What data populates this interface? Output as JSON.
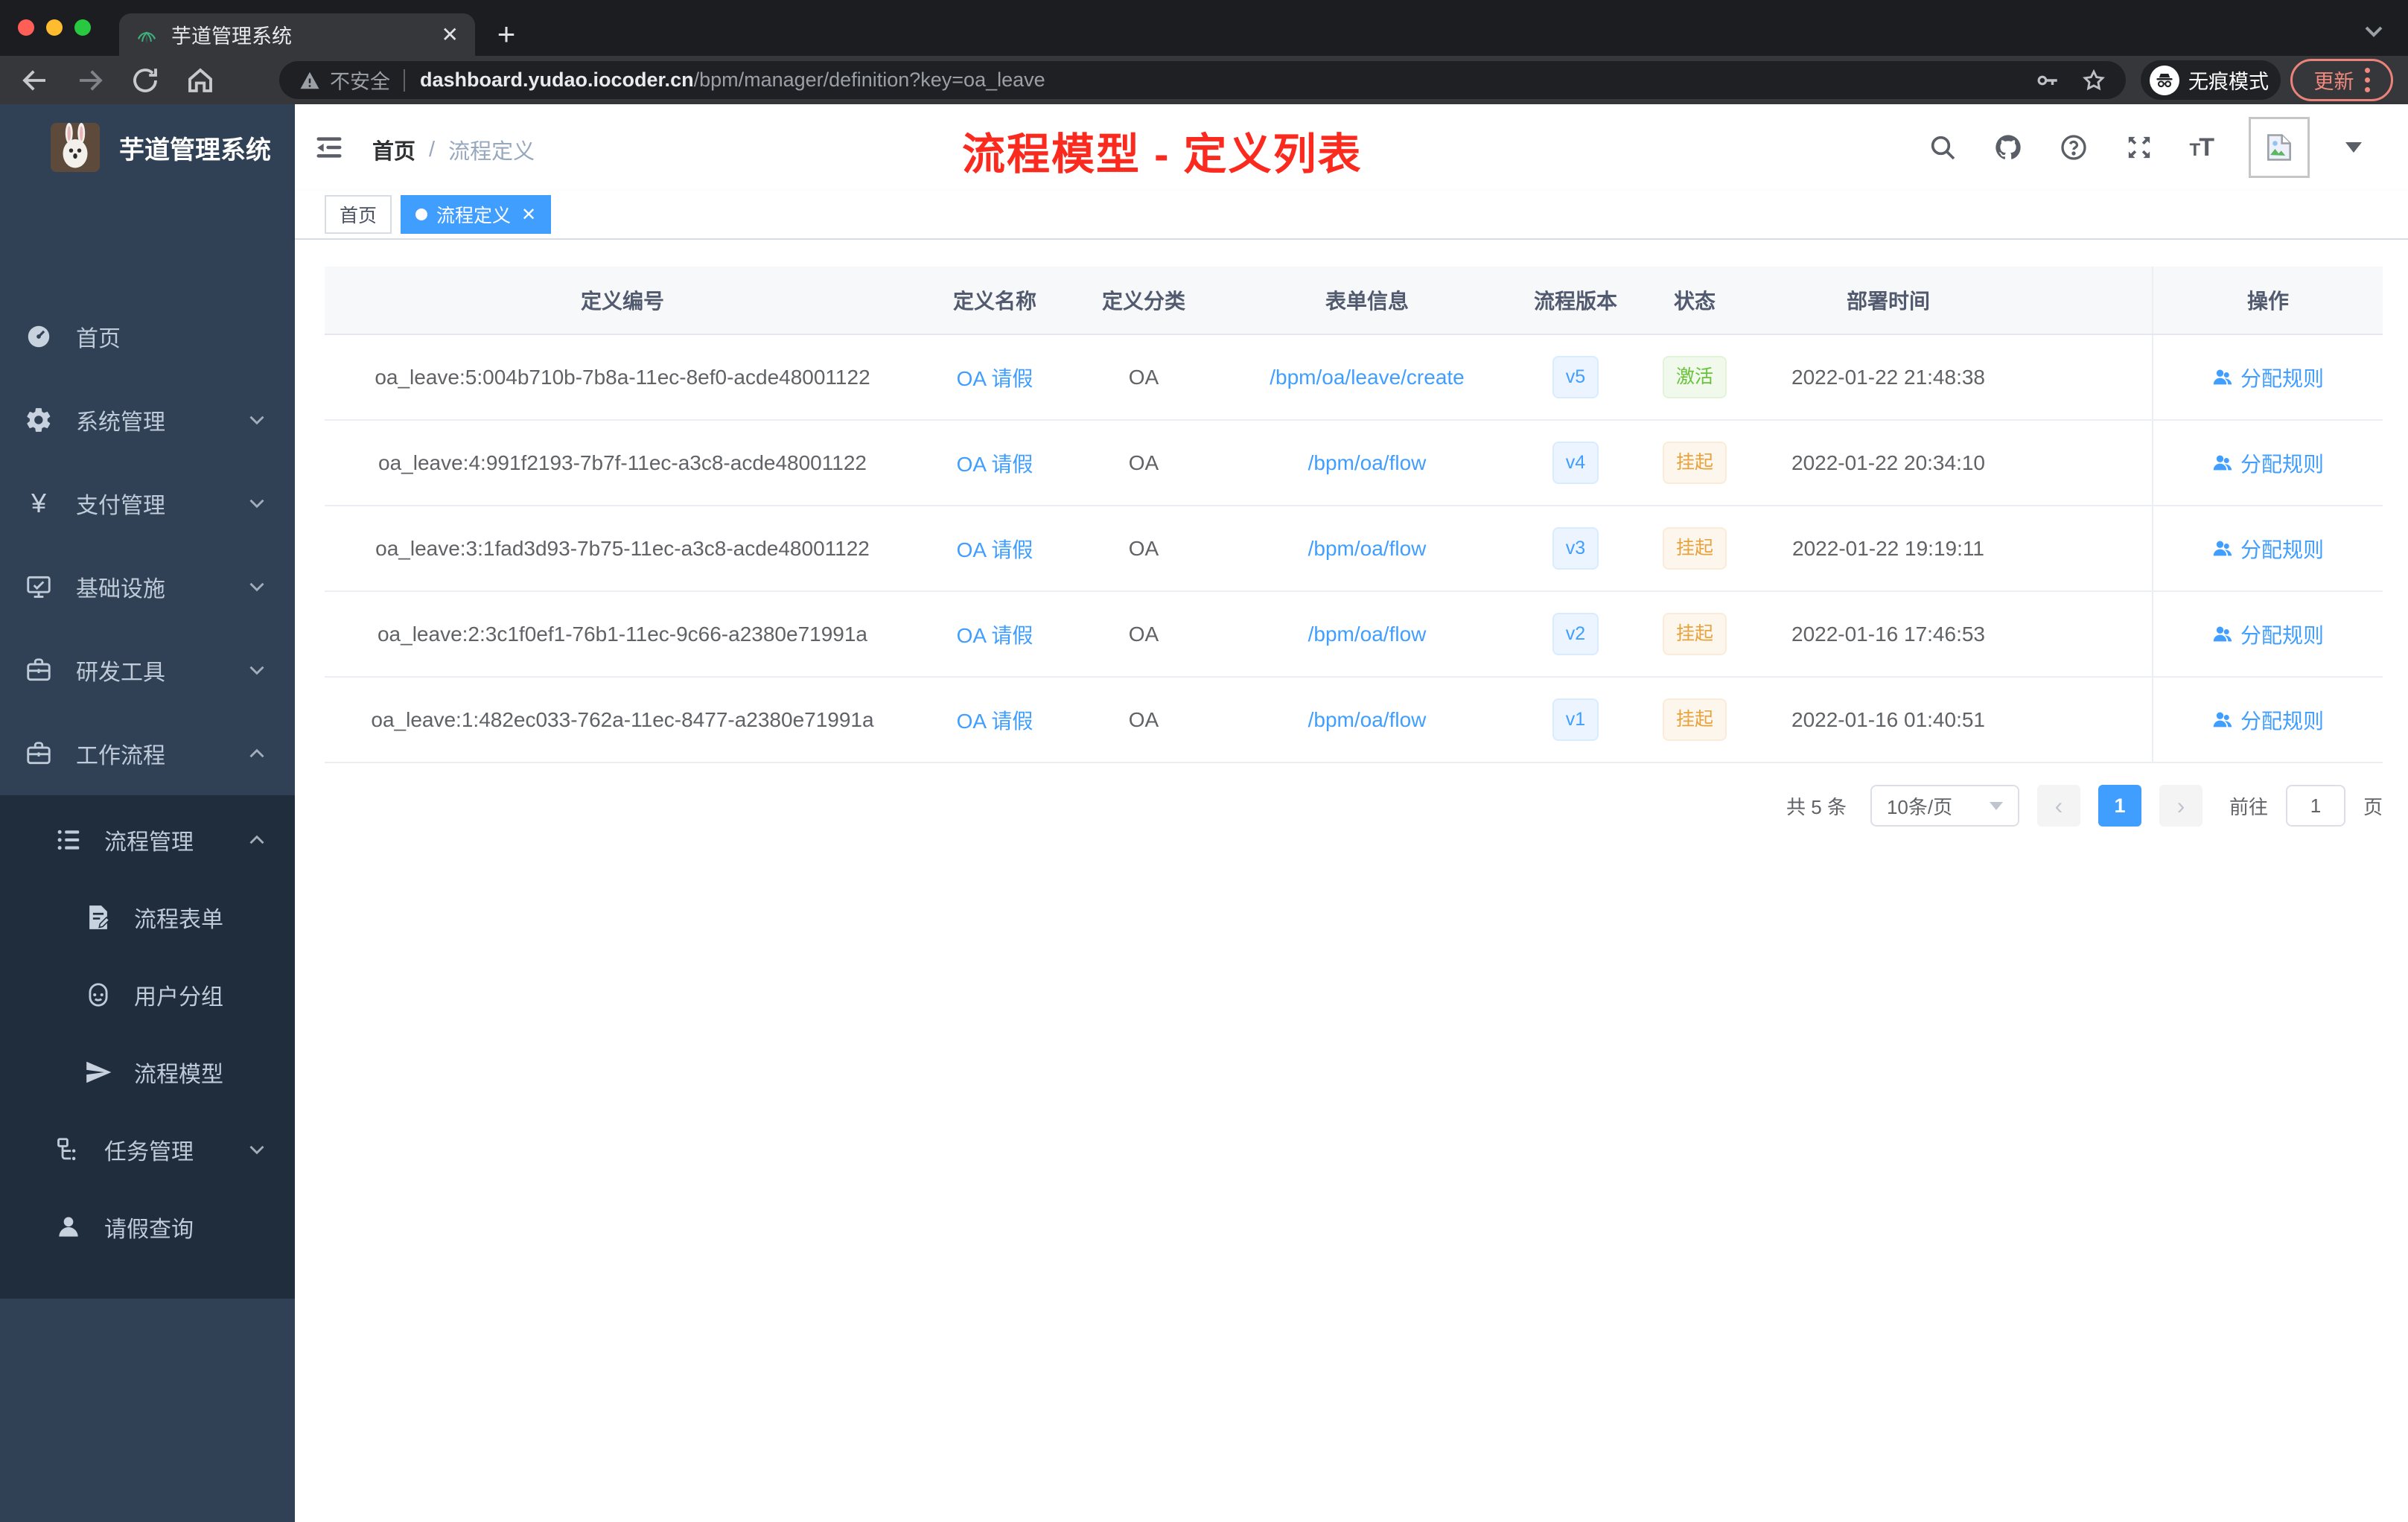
{
  "colors": {
    "accent": "#409eff",
    "sidebar_bg": "#304156",
    "submenu_bg": "#1f2d3d",
    "sidebar_text": "#bfcbd9",
    "success": "#67c23a",
    "warning": "#e6a23c",
    "annotation_red": "#fb2a1f",
    "chrome_dark": "#1c1d20",
    "toolbar_dark": "#36373a"
  },
  "browser": {
    "tab_title": "芋道管理系统",
    "new_tab_label": "+",
    "security_label": "不安全",
    "url_host": "dashboard.yudao.iocoder.cn",
    "url_path": "/bpm/manager/definition?key=oa_leave",
    "incognito_label": "无痕模式",
    "update_label": "更新"
  },
  "sidebar": {
    "app_title": "芋道管理系统",
    "menu": [
      {
        "label": "首页",
        "icon": "dashboard",
        "level": 1,
        "chevron": "",
        "sub": false
      },
      {
        "label": "系统管理",
        "icon": "gear",
        "level": 1,
        "chevron": "down",
        "sub": false
      },
      {
        "label": "支付管理",
        "icon": "yen",
        "level": 1,
        "chevron": "down",
        "sub": false
      },
      {
        "label": "基础设施",
        "icon": "monitor",
        "level": 1,
        "chevron": "down",
        "sub": false
      },
      {
        "label": "研发工具",
        "icon": "briefcase",
        "level": 1,
        "chevron": "down",
        "sub": false
      },
      {
        "label": "工作流程",
        "icon": "briefcase",
        "level": 1,
        "chevron": "up",
        "sub": false
      },
      {
        "label": "流程管理",
        "icon": "treelist",
        "level": 2,
        "chevron": "up",
        "sub": true
      },
      {
        "label": "流程表单",
        "icon": "form",
        "level": 3,
        "chevron": "",
        "sub": true
      },
      {
        "label": "用户分组",
        "icon": "usergroup",
        "level": 3,
        "chevron": "",
        "sub": true
      },
      {
        "label": "流程模型",
        "icon": "send",
        "level": 3,
        "chevron": "",
        "sub": true
      },
      {
        "label": "任务管理",
        "icon": "tasktree",
        "level": 2,
        "chevron": "down",
        "sub": true
      },
      {
        "label": "请假查询",
        "icon": "person",
        "level": 2,
        "chevron": "",
        "sub": true
      }
    ]
  },
  "navbar": {
    "breadcrumb": {
      "home": "首页",
      "separator": "/",
      "current": "流程定义"
    }
  },
  "annotation": {
    "text": "流程模型 - 定义列表"
  },
  "tags": {
    "items": [
      {
        "label": "首页",
        "active": false
      },
      {
        "label": "流程定义",
        "active": true
      }
    ]
  },
  "table": {
    "columns": [
      "定义编号",
      "定义名称",
      "定义分类",
      "表单信息",
      "流程版本",
      "状态",
      "部署时间",
      "操作"
    ],
    "action_label": "分配规则",
    "rows": [
      {
        "id": "oa_leave:5:004b710b-7b8a-11ec-8ef0-acde48001122",
        "name": "OA 请假",
        "category": "OA",
        "form": "/bpm/oa/leave/create",
        "version": "v5",
        "status": "激活",
        "status_type": "success",
        "deploy_time": "2022-01-22 21:48:38",
        "action": "分配规则"
      },
      {
        "id": "oa_leave:4:991f2193-7b7f-11ec-a3c8-acde48001122",
        "name": "OA 请假",
        "category": "OA",
        "form": "/bpm/oa/flow",
        "version": "v4",
        "status": "挂起",
        "status_type": "warning",
        "deploy_time": "2022-01-22 20:34:10",
        "action": "分配规则"
      },
      {
        "id": "oa_leave:3:1fad3d93-7b75-11ec-a3c8-acde48001122",
        "name": "OA 请假",
        "category": "OA",
        "form": "/bpm/oa/flow",
        "version": "v3",
        "status": "挂起",
        "status_type": "warning",
        "deploy_time": "2022-01-22 19:19:11",
        "action": "分配规则"
      },
      {
        "id": "oa_leave:2:3c1f0ef1-76b1-11ec-9c66-a2380e71991a",
        "name": "OA 请假",
        "category": "OA",
        "form": "/bpm/oa/flow",
        "version": "v2",
        "status": "挂起",
        "status_type": "warning",
        "deploy_time": "2022-01-16 17:46:53",
        "action": "分配规则"
      },
      {
        "id": "oa_leave:1:482ec033-762a-11ec-8477-a2380e71991a",
        "name": "OA 请假",
        "category": "OA",
        "form": "/bpm/oa/flow",
        "version": "v1",
        "status": "挂起",
        "status_type": "warning",
        "deploy_time": "2022-01-16 01:40:51",
        "action": "分配规则"
      }
    ]
  },
  "pagination": {
    "total": "共 5 条",
    "page_size": "10条/页",
    "prev": "‹",
    "current_page": "1",
    "next": "›",
    "goto_label": "前往",
    "goto_value": "1",
    "page_unit": "页"
  }
}
